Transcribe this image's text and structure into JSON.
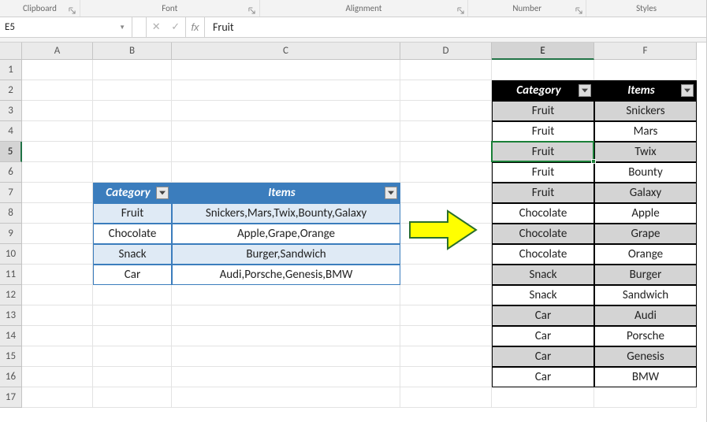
{
  "ribbon": {
    "groups": [
      "Clipboard",
      "Font",
      "Alignment",
      "Number",
      "Styles"
    ]
  },
  "namebox": {
    "ref": "E5"
  },
  "formula": {
    "fx_label": "fx",
    "value": "Fruit"
  },
  "columns": [
    "A",
    "B",
    "C",
    "D",
    "E",
    "F"
  ],
  "row_count": 17,
  "active": {
    "col": "E",
    "row": 5
  },
  "table1": {
    "headers": {
      "category": "Category",
      "items": "Items"
    },
    "rows": [
      {
        "category": "Fruit",
        "items": "Snickers,Mars,Twix,Bounty,Galaxy"
      },
      {
        "category": "Chocolate",
        "items": "Apple,Grape,Orange"
      },
      {
        "category": "Snack",
        "items": "Burger,Sandwich"
      },
      {
        "category": "Car",
        "items": "Audi,Porsche,Genesis,BMW"
      }
    ]
  },
  "table2": {
    "headers": {
      "category": "Category",
      "items": "Items"
    },
    "rows": [
      {
        "category": "Fruit",
        "items": "Snickers"
      },
      {
        "category": "Fruit",
        "items": "Mars"
      },
      {
        "category": "Fruit",
        "items": "Twix"
      },
      {
        "category": "Fruit",
        "items": "Bounty"
      },
      {
        "category": "Fruit",
        "items": "Galaxy"
      },
      {
        "category": "Chocolate",
        "items": "Apple"
      },
      {
        "category": "Chocolate",
        "items": "Grape"
      },
      {
        "category": "Chocolate",
        "items": "Orange"
      },
      {
        "category": "Snack",
        "items": "Burger"
      },
      {
        "category": "Snack",
        "items": "Sandwich"
      },
      {
        "category": "Car",
        "items": "Audi"
      },
      {
        "category": "Car",
        "items": "Porsche"
      },
      {
        "category": "Car",
        "items": "Genesis"
      },
      {
        "category": "Car",
        "items": "BMW"
      }
    ]
  }
}
